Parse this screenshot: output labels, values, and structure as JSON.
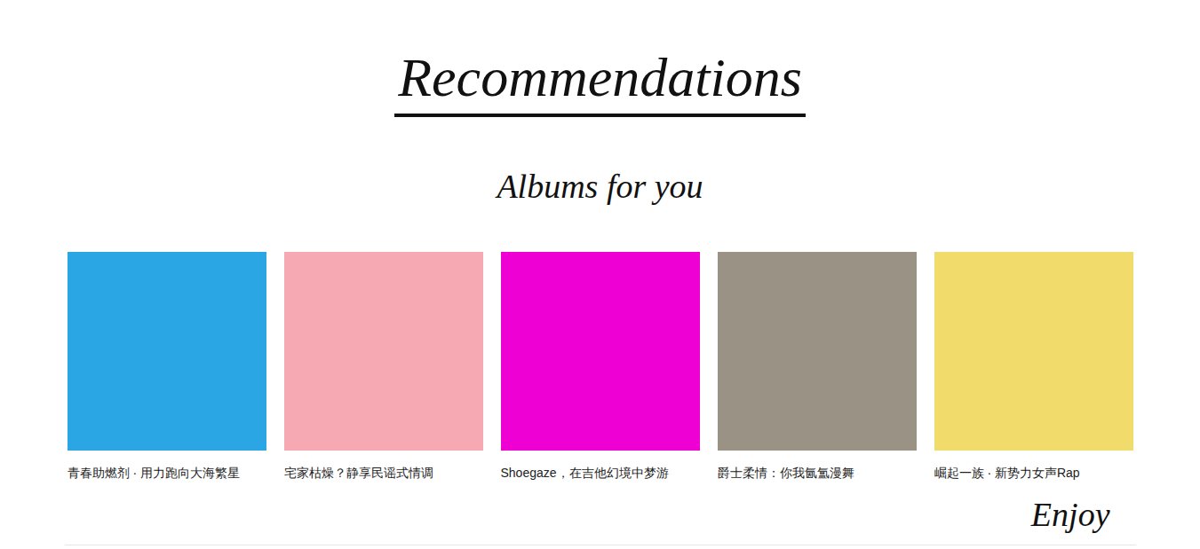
{
  "page": {
    "title": "Recommendations",
    "subtitle": "Albums for you",
    "footer": "Enjoy"
  },
  "albums": [
    {
      "caption": "青春助燃剂 · 用力跑向大海繁星",
      "color": "#2aa6e4"
    },
    {
      "caption": "宅家枯燥？静享民谣式情调",
      "color": "#f6a9b3"
    },
    {
      "caption": "Shoegaze，在吉他幻境中梦游",
      "color": "#ee00d4"
    },
    {
      "caption": "爵士柔情：你我氤氲漫舞",
      "color": "#9b9286"
    },
    {
      "caption": "崛起一族 · 新势力女声Rap",
      "color": "#f1db6a"
    }
  ]
}
